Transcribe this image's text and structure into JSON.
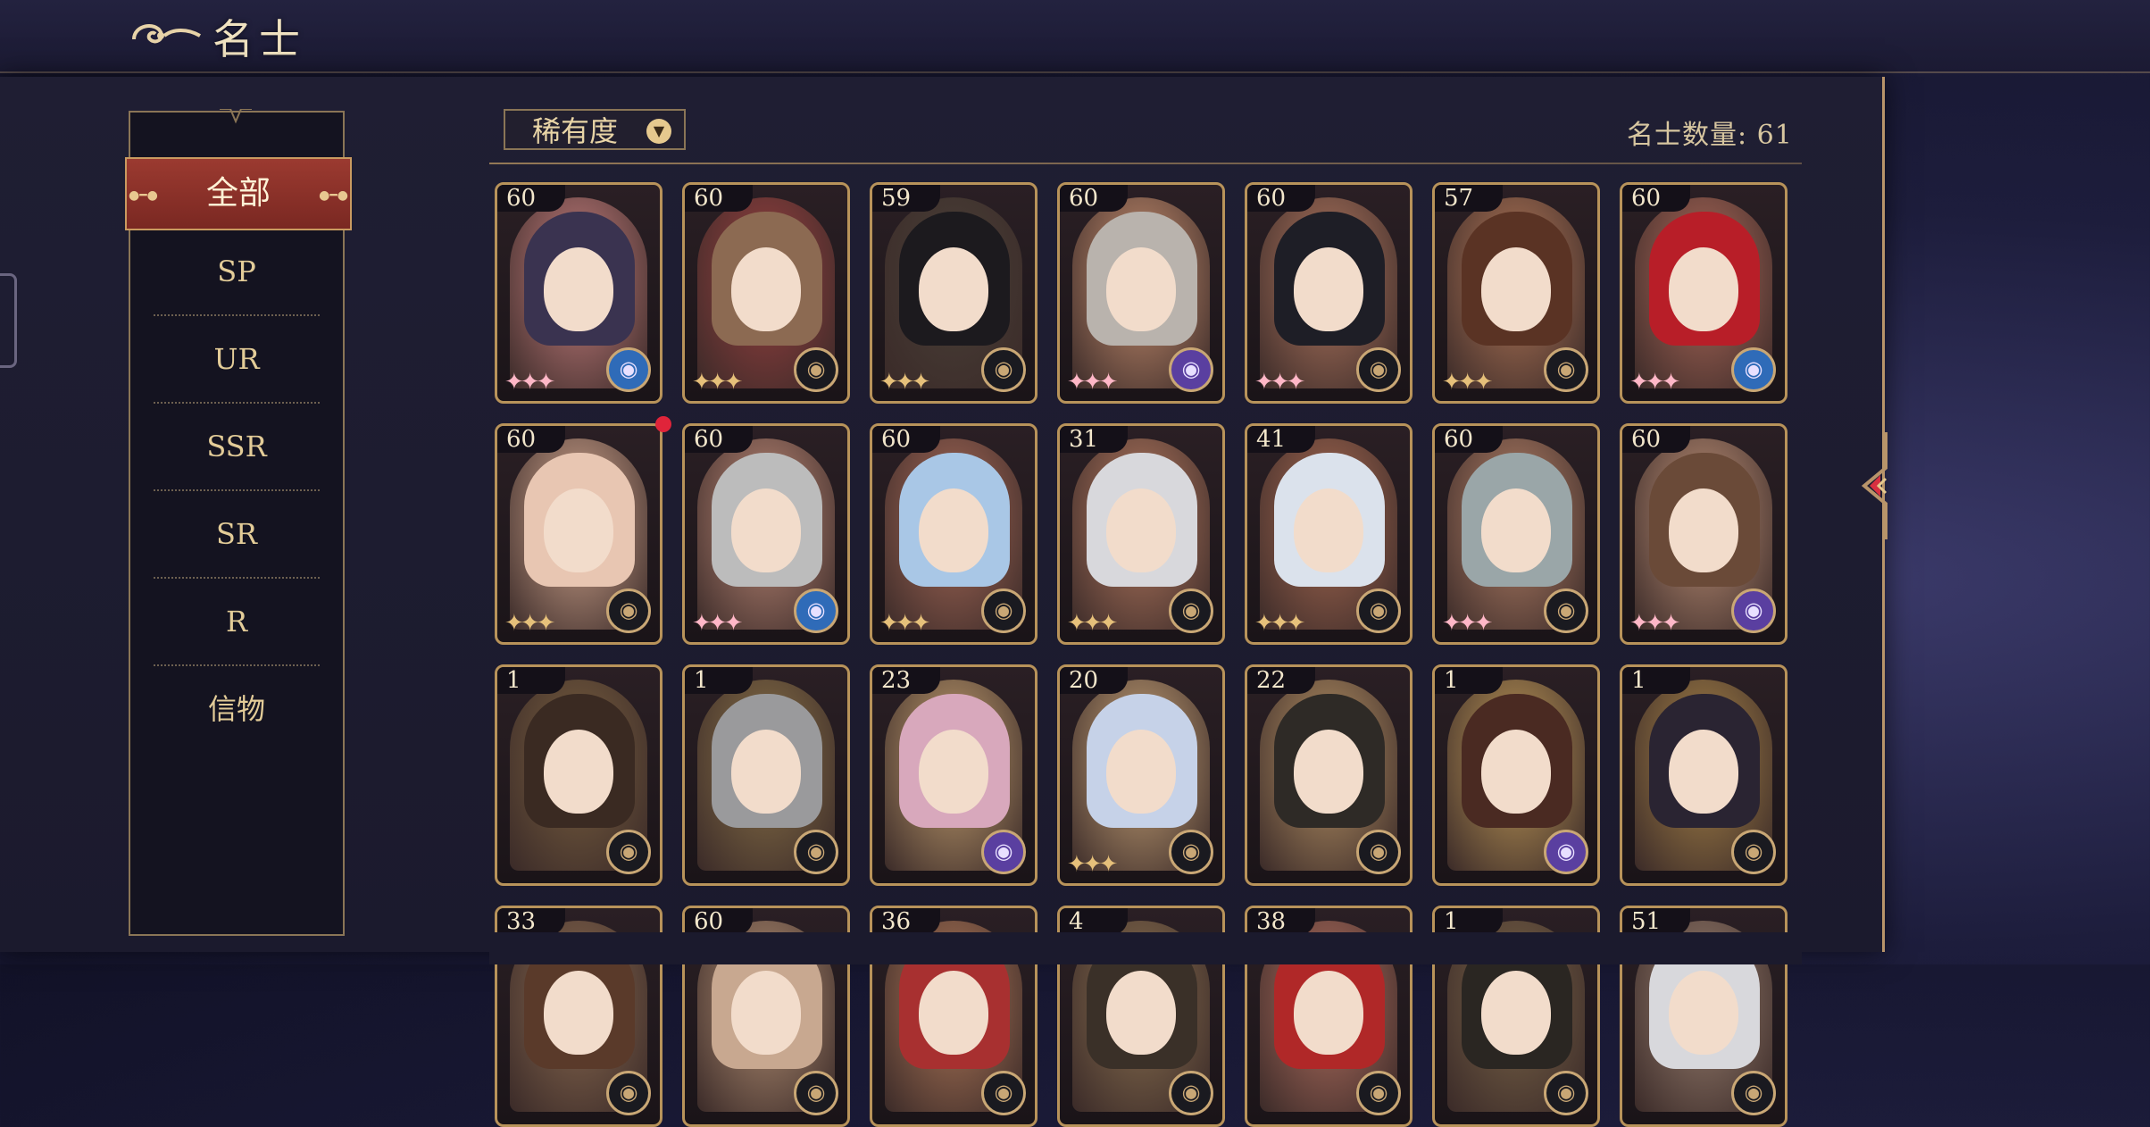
{
  "header": {
    "title": "名士",
    "icon": "cloud-swirl-icon"
  },
  "sidebar": {
    "items": [
      {
        "label": "全部",
        "active": true
      },
      {
        "label": "SP"
      },
      {
        "label": "UR"
      },
      {
        "label": "SSR"
      },
      {
        "label": "SR"
      },
      {
        "label": "R"
      },
      {
        "label": "信物"
      }
    ]
  },
  "toolbar": {
    "sort_label": "稀有度",
    "sort_icon": "chevron-down-icon",
    "count_text": "名士数量: 61"
  },
  "cards": [
    {
      "level": "60",
      "bg": "#c98080",
      "hair": "#3a3350",
      "stars": "pink",
      "faction": "blue"
    },
    {
      "level": "60",
      "bg": "#9a4040",
      "hair": "#8c6a52",
      "stars": "gold",
      "faction": "gold"
    },
    {
      "level": "59",
      "bg": "#4a4038",
      "hair": "#1c1a1e",
      "stars": "gold",
      "faction": "gold"
    },
    {
      "level": "60",
      "bg": "#c99070",
      "hair": "#b9b3ad",
      "stars": "pink",
      "faction": "purple"
    },
    {
      "level": "60",
      "bg": "#b27860",
      "hair": "#1e1e26",
      "stars": "pink",
      "faction": "gold"
    },
    {
      "level": "57",
      "bg": "#b47858",
      "hair": "#5a3324",
      "stars": "gold",
      "faction": "gold"
    },
    {
      "level": "60",
      "bg": "#b06a5a",
      "hair": "#b81e28",
      "stars": "pink",
      "faction": "blue"
    },
    {
      "level": "60",
      "bg": "#d4a890",
      "hair": "#e8c6b2",
      "stars": "gold",
      "faction": "gold",
      "new": true
    },
    {
      "level": "60",
      "bg": "#bf8a78",
      "hair": "#bcbcbc",
      "stars": "pink",
      "faction": "blue"
    },
    {
      "level": "60",
      "bg": "#a86a58",
      "hair": "#a9c7e6",
      "stars": "gold",
      "faction": "gold"
    },
    {
      "level": "31",
      "bg": "#b67a60",
      "hair": "#d8d8dc",
      "stars": "gold",
      "faction": "gold"
    },
    {
      "level": "41",
      "bg": "#a86a52",
      "hair": "#dbe2ec",
      "stars": "gold",
      "faction": "gold"
    },
    {
      "level": "60",
      "bg": "#b68268",
      "hair": "#9aa6a8",
      "stars": "pink",
      "faction": "gold"
    },
    {
      "level": "60",
      "bg": "#c09278",
      "hair": "#6a4a38",
      "stars": "pink",
      "faction": "purple"
    },
    {
      "level": "1",
      "bg": "#7a6040",
      "hair": "#3a2a22",
      "stars": "none",
      "faction": "gold"
    },
    {
      "level": "1",
      "bg": "#8a7248",
      "hair": "#9a9a9c",
      "stars": "none",
      "faction": "gold"
    },
    {
      "level": "23",
      "bg": "#c4a070",
      "hair": "#d8a8bc",
      "stars": "none",
      "faction": "purple"
    },
    {
      "level": "20",
      "bg": "#c8a478",
      "hair": "#c6d2e8",
      "stars": "gold",
      "faction": "gold"
    },
    {
      "level": "22",
      "bg": "#b89466",
      "hair": "#2e2a26",
      "stars": "none",
      "faction": "gold"
    },
    {
      "level": "1",
      "bg": "#c09a58",
      "hair": "#4a2a22",
      "stars": "none",
      "faction": "purple"
    },
    {
      "level": "1",
      "bg": "#a88448",
      "hair": "#2a2432",
      "stars": "none",
      "faction": "gold"
    },
    {
      "level": "33",
      "bg": "#8a6a50",
      "hair": "#5a3a2a",
      "stars": "none",
      "faction": "gold"
    },
    {
      "level": "60",
      "bg": "#b49074",
      "hair": "#c8a890",
      "stars": "none",
      "faction": "gold"
    },
    {
      "level": "36",
      "bg": "#b07858",
      "hair": "#a83030",
      "stars": "none",
      "faction": "gold"
    },
    {
      "level": "4",
      "bg": "#8a7050",
      "hair": "#3a3028",
      "stars": "none",
      "faction": "gold"
    },
    {
      "level": "38",
      "bg": "#b47060",
      "hair": "#b02828",
      "stars": "none",
      "faction": "gold"
    },
    {
      "level": "1",
      "bg": "#7a6448",
      "hair": "#2a2622",
      "stars": "none",
      "faction": "gold"
    },
    {
      "level": "51",
      "bg": "#9a8070",
      "hair": "#d8d8dc",
      "stars": "none",
      "faction": "gold"
    }
  ],
  "colors": {
    "accent_red": "#8a2f28",
    "gold_border": "#b8935a",
    "star_pink": "#ffb7c7",
    "star_gold": "#e6c07a",
    "faction_blue": "#2f6bb8",
    "faction_purple": "#5a3fa0",
    "faction_gold": "#c9a775"
  },
  "arrow_icon": "arrow-left-icon"
}
